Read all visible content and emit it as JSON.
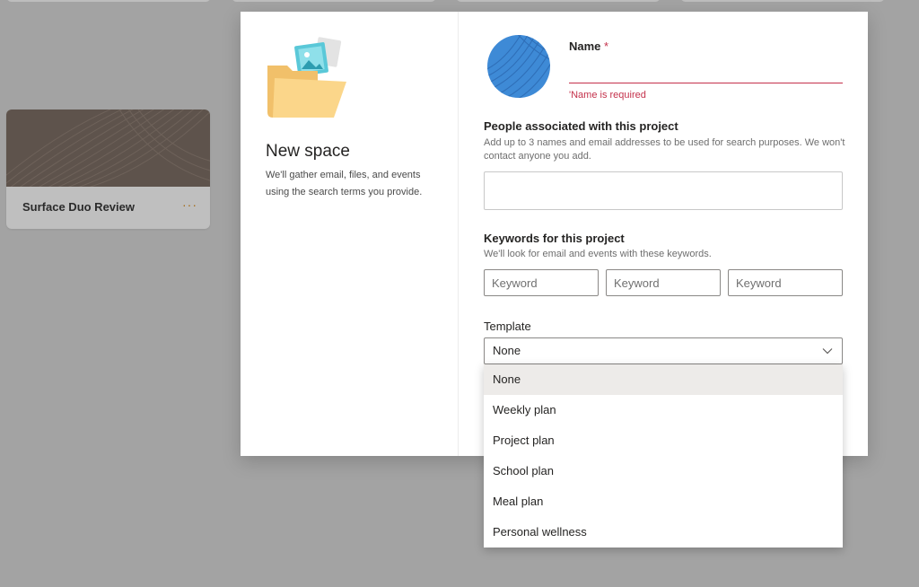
{
  "background": {
    "card": {
      "title": "Surface Duo Review",
      "more_label": "···"
    }
  },
  "dialog": {
    "left": {
      "title": "New space",
      "description": "We'll gather email, files, and events using the search terms you provide."
    },
    "name": {
      "label": "Name",
      "required_marker": "*",
      "value": "",
      "error": "'Name is required"
    },
    "people": {
      "label": "People associated with this project",
      "help": "Add up to 3 names and email addresses to be used for search purposes. We won't contact anyone you add.",
      "value": ""
    },
    "keywords": {
      "label": "Keywords for this project",
      "help": "We'll look for email and events with these keywords.",
      "inputs": [
        {
          "placeholder": "Keyword",
          "value": ""
        },
        {
          "placeholder": "Keyword",
          "value": ""
        },
        {
          "placeholder": "Keyword",
          "value": ""
        }
      ]
    },
    "template": {
      "label": "Template",
      "selected": "None",
      "options": [
        "None",
        "Weekly plan",
        "Project plan",
        "School plan",
        "Meal plan",
        "Personal wellness"
      ]
    }
  },
  "colors": {
    "overlay": "#a3a3a3",
    "error": "#c4314b",
    "avatar": "#3e8ad6",
    "card_cover": "#5e534c",
    "selected_option_bg": "#edebe9"
  },
  "icons": {
    "folder": "folder-with-photo-icon",
    "avatar_pattern": "striped-circle-avatar",
    "dropdown": "chevron-down-icon",
    "more": "more-dots-icon"
  }
}
